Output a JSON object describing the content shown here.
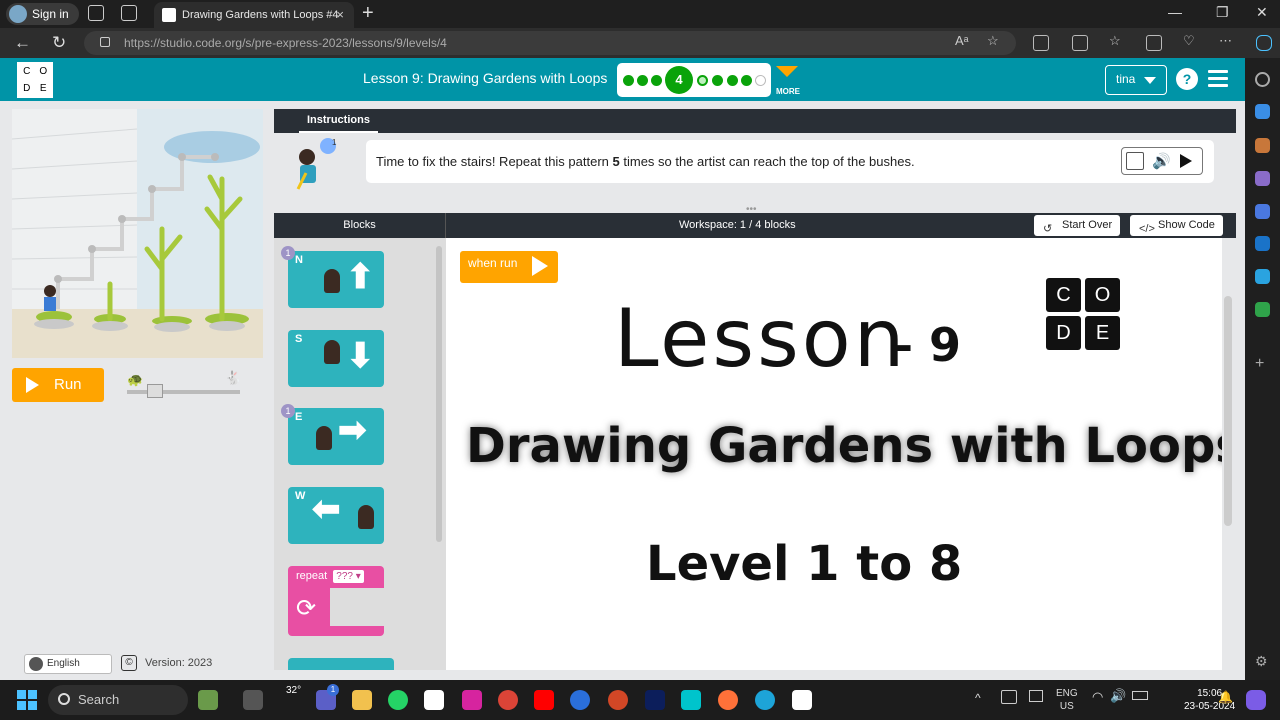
{
  "browser": {
    "signin_label": "Sign in",
    "tab_title": "Drawing Gardens with Loops #4",
    "tab_close": "×",
    "new_tab": "+",
    "url": "https://studio.code.org/s/pre-express-2023/lessons/9/levels/4",
    "read_aloud": "Aᵃ"
  },
  "header": {
    "logo_letters": [
      "C",
      "O",
      "D",
      "E"
    ],
    "lesson_title": "Lesson 9: Drawing Gardens with Loops",
    "current_level": "4",
    "more_label": "MORE",
    "user_name": "tina",
    "help": "?"
  },
  "left": {
    "run_label": "Run",
    "language": "English",
    "version": "Version: 2023",
    "copyright": "©"
  },
  "instructions": {
    "tab_label": "Instructions",
    "hint_count": "1",
    "text_before": "Time to fix the stairs! Repeat this pattern ",
    "text_bold": "5",
    "text_after": " times so the artist can reach the top of the bushes."
  },
  "workspace_bar": {
    "blocks_label": "Blocks",
    "count_label": "Workspace: 1 / 4 blocks",
    "start_over": "Start Over",
    "show_code": "Show Code"
  },
  "toolbox": {
    "blocks": [
      {
        "dir": "N",
        "badge": "1",
        "arrow": "⬆"
      },
      {
        "dir": "S",
        "badge": "",
        "arrow": "⬇"
      },
      {
        "dir": "E",
        "badge": "1",
        "arrow": "➡"
      },
      {
        "dir": "W",
        "badge": "",
        "arrow": "⬅"
      }
    ],
    "repeat_label": "repeat",
    "repeat_value": "???",
    "repeat_caret": "▾"
  },
  "workspace": {
    "when_run": "when run",
    "overlay_lesson": "Lesson",
    "overlay_number": "– 9",
    "overlay_title": "Drawing Gardens with Loops",
    "overlay_level": "Level 1 to 8",
    "overlay_logo": [
      "C",
      "O",
      "D",
      "E"
    ]
  },
  "taskbar": {
    "search_label": "Search",
    "weather": "32°",
    "teams_badge": "1",
    "lang": "ENG",
    "region": "US",
    "time": "15:06",
    "date": "23-05-2024"
  },
  "progress": {
    "completed_before": 3,
    "current": 4,
    "after": [
      "ring",
      "full",
      "full",
      "full",
      "empty"
    ]
  }
}
